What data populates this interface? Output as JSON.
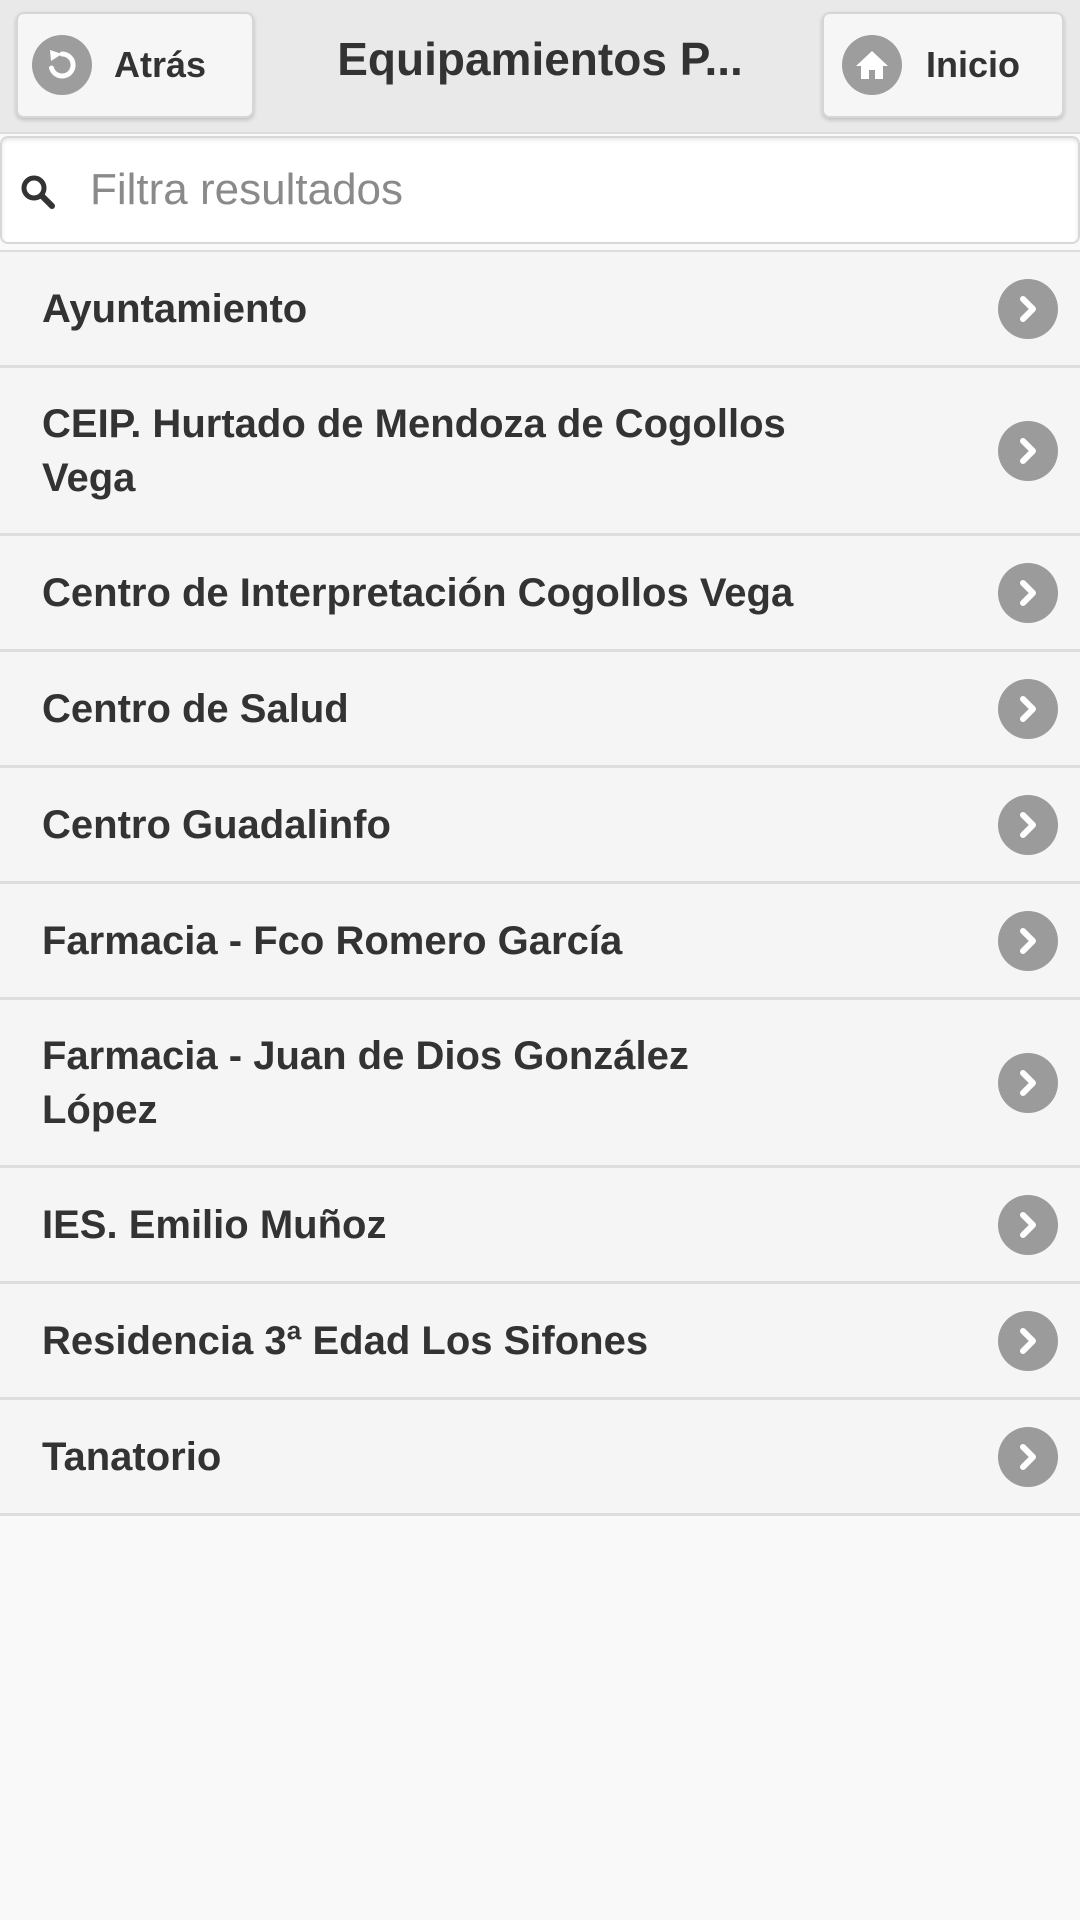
{
  "header": {
    "back_label": "Atrás",
    "title": "Equipamientos P...",
    "home_label": "Inicio"
  },
  "search": {
    "placeholder": "Filtra resultados",
    "value": ""
  },
  "list": {
    "items": [
      {
        "label": "Ayuntamiento"
      },
      {
        "label": "CEIP. Hurtado de Mendoza de Cogollos Vega"
      },
      {
        "label": "Centro de Interpretación Cogollos Vega"
      },
      {
        "label": "Centro de Salud"
      },
      {
        "label": "Centro Guadalinfo"
      },
      {
        "label": "Farmacia - Fco Romero García"
      },
      {
        "label": "Farmacia - Juan de Dios González López"
      },
      {
        "label": "IES. Emilio Muñoz"
      },
      {
        "label": "Residencia 3ª Edad Los Sifones"
      },
      {
        "label": "Tanatorio"
      }
    ]
  },
  "icons": {
    "back": "back-arrow-icon",
    "home": "home-icon",
    "search": "search-icon",
    "item_arrow": "chevron-right-icon"
  },
  "colors": {
    "header_bg": "#e9e9e9",
    "icon_circle": "#9d9d9d",
    "text": "#333333",
    "list_bg": "#f5f5f5"
  }
}
